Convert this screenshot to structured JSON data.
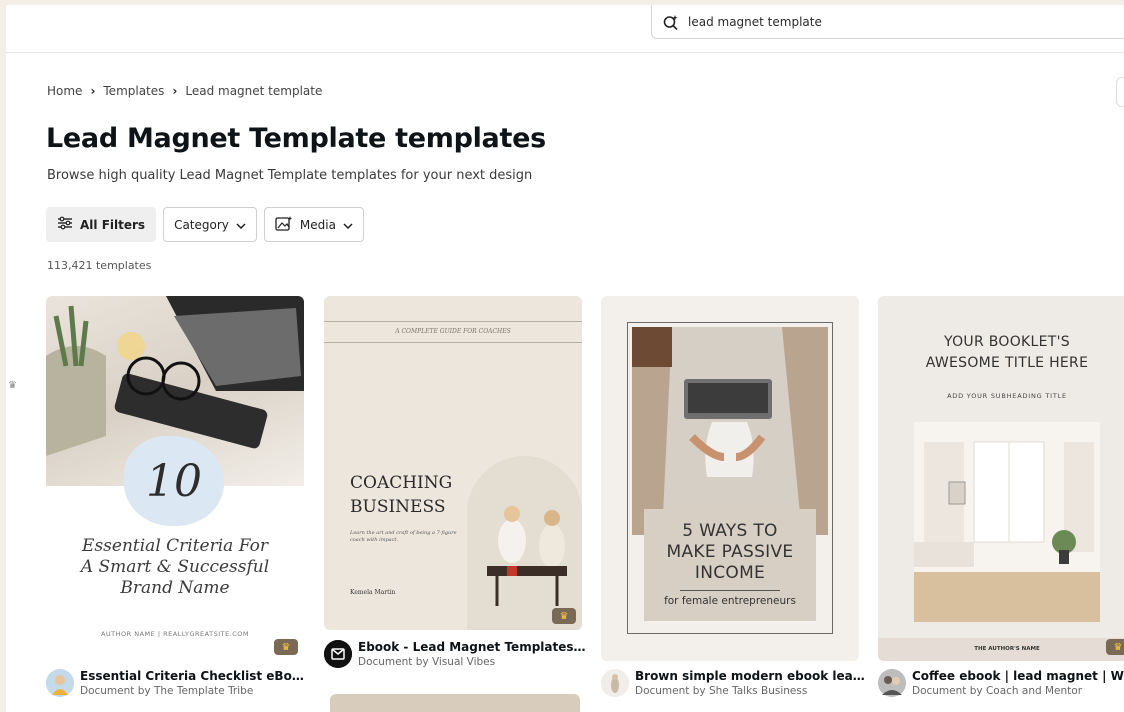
{
  "search": {
    "value": "lead magnet template",
    "icon": "sparkle-search-icon"
  },
  "breadcrumb": {
    "home": "Home",
    "templates": "Templates",
    "current": "Lead magnet template"
  },
  "page": {
    "title": "Lead Magnet Template templates",
    "subtitle": "Browse high quality Lead Magnet Template templates for your next design",
    "count": "113,421 templates"
  },
  "filters": {
    "all": "All Filters",
    "category": "Category",
    "media": "Media"
  },
  "cards": [
    {
      "title": "Essential Criteria Checklist eBook Le...",
      "by": "Document by The Template Tribe",
      "thumb": {
        "number": "10",
        "body": "Essential Criteria For A Smart & Successful Brand Name",
        "author": "AUTHOR NAME | REALLYGREATSITE.COM"
      }
    },
    {
      "title": "Ebook - Lead Magnet Templates for ...",
      "by": "Document by Visual Vibes",
      "thumb": {
        "guide": "A COMPLETE GUIDE FOR COACHES",
        "heading1": "COACHING",
        "heading2": "BUSINESS",
        "small": "Learn the art and craft of being a 7-figure coach with impact.",
        "name": "Kemela Martin"
      }
    },
    {
      "title": "Brown simple modern ebook lead m...",
      "by": "Document by She Talks Business",
      "thumb": {
        "big1": "5 WAYS TO",
        "big2": "MAKE PASSIVE",
        "big3": "INCOME",
        "small": "for female entrepreneurs"
      }
    },
    {
      "title": "Coffee ebook | lead magnet | Workb...",
      "by": "Document by Coach and Mentor",
      "thumb": {
        "h1": "YOUR BOOKLET'S",
        "h2": "AWESOME TITLE HERE",
        "sub": "ADD YOUR SUBHEADING TITLE",
        "author": "THE AUTHOR'S NAME"
      }
    }
  ],
  "colors": {
    "accent": "#7d2ae8",
    "crown": "#ffc73a"
  }
}
